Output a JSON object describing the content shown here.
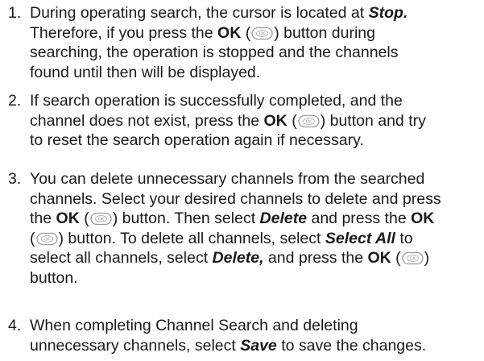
{
  "items": [
    {
      "number": "1.",
      "line1_a": "During operating search, the cursor is located at ",
      "line1_stop": "Stop.",
      "line2_a": "Therefore, if you press the ",
      "ok": "OK",
      "line2_b": " button during",
      "line3": "searching, the operation is stopped and the channels",
      "line4": "found until then will be displayed."
    },
    {
      "number": "2.",
      "line1": "If search operation is successfully completed, and the",
      "line2_a": "channel does not exist, press the ",
      "ok": "OK",
      "line2_b": " button and try",
      "line3": "to reset the search operation again if necessary."
    },
    {
      "number": "3.",
      "line1": "You can delete unnecessary channels from the searched",
      "line2": "channels. Select your desired channels to delete and press",
      "line3_a": "the ",
      "ok": "OK",
      "line3_b": " button. Then select ",
      "delete": "Delete",
      "line3_c": " and press the ",
      "line4_b": " button. To delete all channels, select ",
      "select_all": "Select All",
      "line4_c": " to",
      "line5_a": "select all channels, select ",
      "delete_comma": "Delete,",
      "line5_b": " and press the ",
      "line6": "button."
    },
    {
      "number": "4.",
      "line1": "When completing Channel Search and deleting",
      "line2_a": "unnecessary channels, select ",
      "save": "Save",
      "line2_b": " to save the changes."
    }
  ],
  "icons": {
    "ok_button_icon": "ok-key-icon",
    "icon_color": "#9a9a9a"
  }
}
